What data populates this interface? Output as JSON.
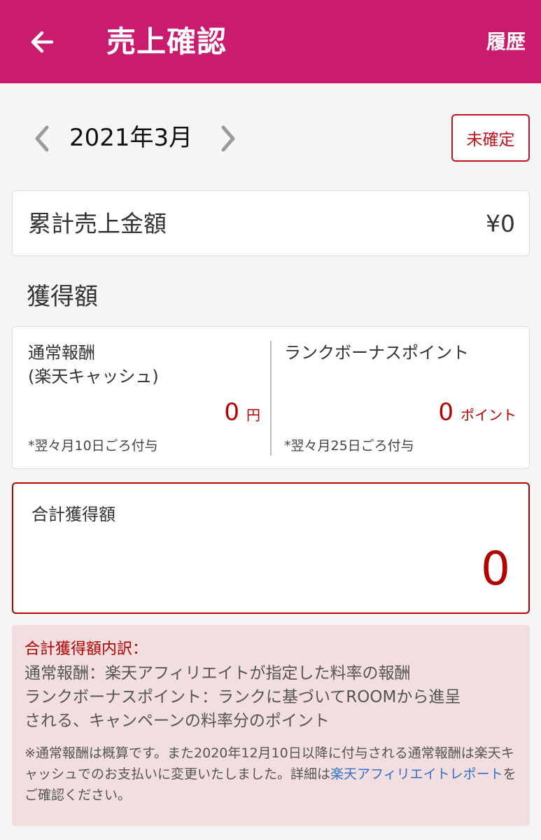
{
  "appbar": {
    "back_icon": "arrow-left-icon",
    "title": "売上確認",
    "history_label": "履歴",
    "background": "#c91c6e"
  },
  "month_nav": {
    "prev_icon": "chevron-left-icon",
    "next_icon": "chevron-right-icon",
    "month": "2021年3月",
    "status": "未確定"
  },
  "total_sales": {
    "label": "累計売上金額",
    "value": "¥0"
  },
  "earnings": {
    "heading": "獲得額",
    "regular": {
      "title_line1": "通常報酬",
      "title_line2": "(楽天キャッシュ)",
      "amount": "0",
      "unit": "円",
      "note": "*翌々月10日ごろ付与"
    },
    "bonus": {
      "title": "ランクボーナスポイント",
      "amount": "0",
      "unit": "ポイント",
      "note": "*翌々月25日ごろ付与"
    }
  },
  "grand_total": {
    "label": "合計獲得額",
    "value": "0"
  },
  "breakdown": {
    "title": "合計獲得額内訳：",
    "line1": "通常報酬：楽天アフィリエイトが指定した料率の報酬",
    "line2": "ランクボーナスポイント：ランクに基づいてROOMから進呈",
    "line3": "される、キャンペーンの料率分のポイント",
    "note_prefix": "※通常報酬は概算です。また2020年12月10日以降に付与される通常報酬は楽天キャッシュでのお支払いに変更いたしました。詳細は",
    "note_link": "楽天アフィリエイトレポート",
    "note_suffix": "をご確認ください。"
  },
  "colors": {
    "accent": "#c91c6e",
    "amount_red": "#b30000",
    "link_blue": "#2f6fcf",
    "info_bg": "#f2dede"
  }
}
